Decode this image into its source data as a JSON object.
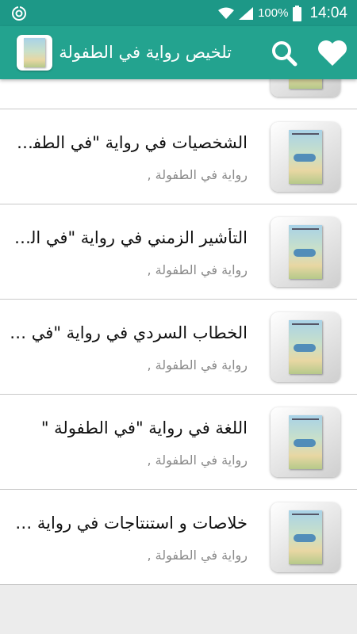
{
  "status_bar": {
    "battery_text": "100%",
    "time": "14:04"
  },
  "app_bar": {
    "title": "تلخيص رواية في الطفولة",
    "icons": [
      "app-logo",
      "search-icon",
      "heart-icon"
    ]
  },
  "list": {
    "items": [
      {
        "title": "الشخصيات  في رواية \"في الطفولة\"",
        "subtitle": "رواية في الطفولة   ,"
      },
      {
        "title": "التأشير الزمني  في رواية \"في الطفولة\"",
        "subtitle": "رواية في الطفولة   ,"
      },
      {
        "title": "الخطاب السردي في رواية \"في الطفولة\"",
        "subtitle": "رواية في الطفولة   ,"
      },
      {
        "title": "اللغة في  رواية \"في الطفولة \"",
        "subtitle": "رواية في الطفولة   ,"
      },
      {
        "title": "خلاصات و استنتاجات في رواية في الطفولة",
        "subtitle": "رواية في الطفولة   ,"
      }
    ]
  },
  "colors": {
    "status_bar": "#1d9887",
    "app_bar": "#23a38f",
    "background": "#ececec"
  }
}
